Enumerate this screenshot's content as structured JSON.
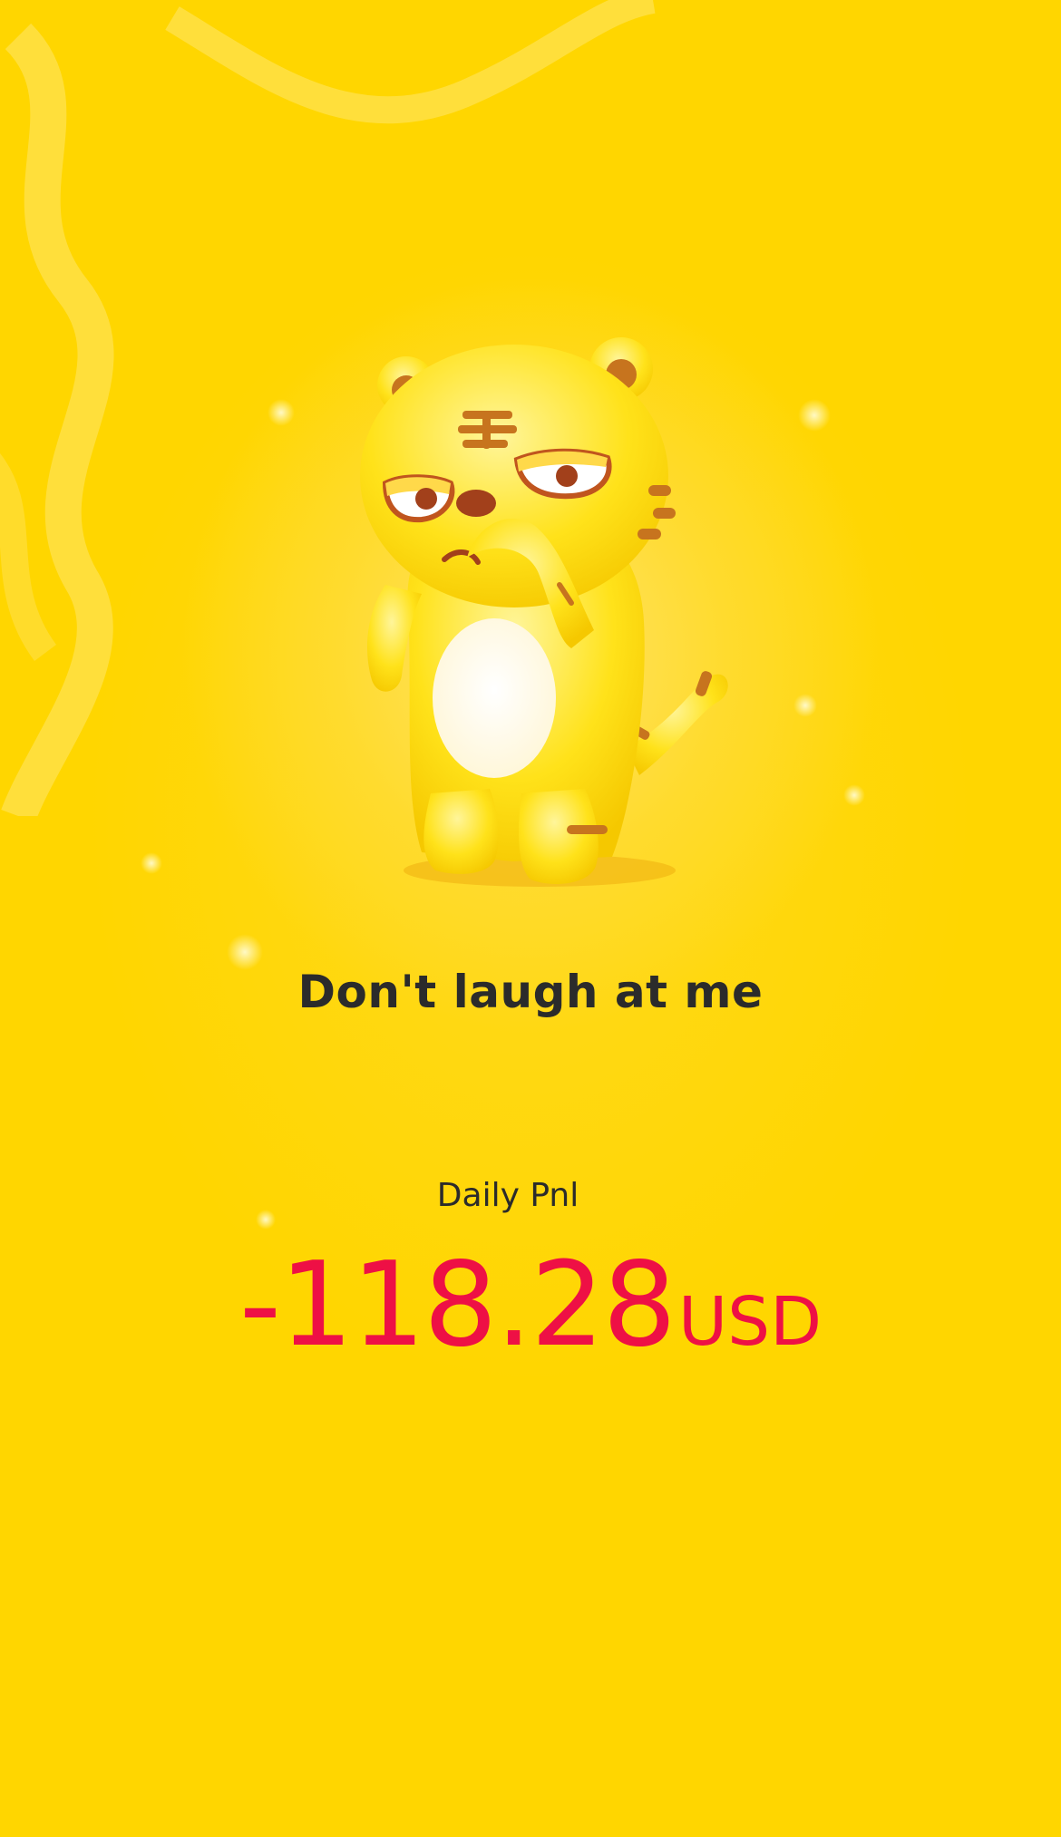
{
  "screen": {
    "tagline": "Don't laugh at me",
    "mascot_icon": "tiger-mascot-icon"
  },
  "pnl": {
    "label": "Daily Pnl",
    "value": "-118.28",
    "unit": "USD"
  },
  "colors": {
    "background": "#ffd600",
    "loss_red": "#ee1045",
    "text_dark": "#2b2b2b"
  }
}
